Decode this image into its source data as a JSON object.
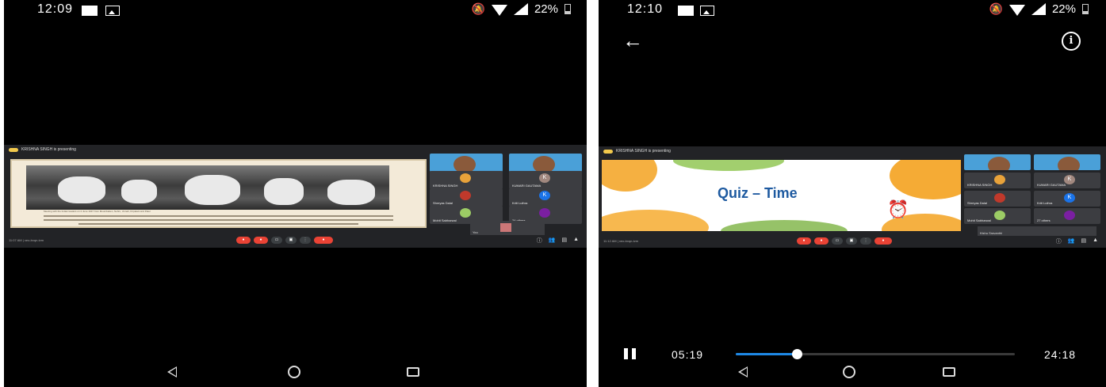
{
  "left_phone": {
    "status_time": "12:09",
    "battery_pct": "22%",
    "presenter_banner": "KRISHNA SINGH is presenting",
    "caption": "Meeting with the Indian leaders on 2 June 1947 from Mountbatten, Nehru, Jinnah, Kripalani and Patel",
    "participants": [
      "KRISHNA SINGH",
      "KUMARI GAUTAMA",
      "Shreyas Dalal",
      "Kriti Luthra",
      "Mohit Sabharwal",
      "24 others"
    ],
    "self_label": "You",
    "meeting_clock": "11:07 AM",
    "meeting_code": "xeo-bxqn-tvm"
  },
  "right_phone": {
    "status_time": "12:10",
    "battery_pct": "22%",
    "presenter_banner": "KRISHNA SINGH is presenting",
    "slide_title": "Quiz – Time",
    "participants": [
      "KRISHNA SINGH",
      "KUMARI GAUTAMA",
      "Shreyas Dalal",
      "Kriti Luthra",
      "Mohit Sabharwal",
      "27 others"
    ],
    "self_label": "Kishu Sravanthi",
    "meeting_clock": "11:12 AM",
    "meeting_code": "xeo-bxqn-tvm",
    "player": {
      "elapsed": "05:19",
      "total": "24:18",
      "progress": 0.22
    }
  },
  "icons": [
    "pause-icon",
    "back-arrow-icon",
    "info-icon",
    "wifi-icon",
    "signal-icon",
    "battery-icon",
    "mute-icon",
    "alarm-clock-icon"
  ],
  "colors": {
    "meet_bg": "#222326",
    "accent_blue": "#1e88e5",
    "end_call_red": "#ea4335"
  }
}
